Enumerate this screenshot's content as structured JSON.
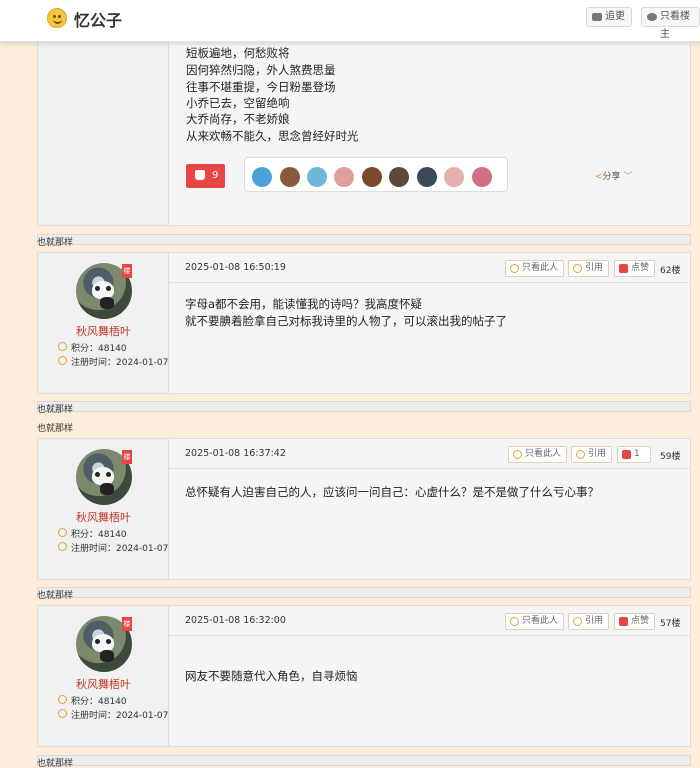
{
  "header": {
    "logo_text": "忆公子",
    "follow_label": "追更",
    "only_op_label": "只看楼主"
  },
  "first_post": {
    "poem_lines": [
      "短板遍地，何愁败将",
      "因何猝然归隐，外人煞费思量",
      "往事不堪重提，今日粉墨登场",
      "小乔已去，空留绝响",
      "大乔尚存，不老娇娘",
      "从来欢畅不能久，思念曾经好时光"
    ],
    "like_count": "9",
    "share_label": "分享",
    "share_arrow": "﹀",
    "likers": [
      "#4aa3d8",
      "#8a5a3c",
      "#6fb7d9",
      "#e0a0a0",
      "#7a4a2a",
      "#5a4a3a",
      "#3a4a5a",
      "#e6b0b0",
      "#d07080"
    ]
  },
  "signature": "也就那样",
  "posts": [
    {
      "badge": "楼",
      "username": "秋风舞梧叶",
      "points": "积分：48140",
      "reg_date": "注册时间：2024-01-07",
      "time": "2025-01-08 16:50:19",
      "only_this_label": "只看此人",
      "quote_label": "引用",
      "like_label": "点赞",
      "floor": "62楼",
      "text": [
        "字母a都不会用，能读懂我的诗吗？我高度怀疑",
        "就不要腆着脸拿自己对标我诗里的人物了，可以滚出我的帖子了"
      ]
    },
    {
      "badge": "楼",
      "username": "秋风舞梧叶",
      "points": "积分：48140",
      "reg_date": "注册时间：2024-01-07",
      "time": "2025-01-08 16:37:42",
      "only_this_label": "只看此人",
      "quote_label": "引用",
      "like_label": "1",
      "floor": "59楼",
      "text": [
        "总怀疑有人迫害自己的人，应该问一问自己：心虚什么？是不是做了什么亏心事？"
      ]
    },
    {
      "badge": "楼",
      "username": "秋风舞梧叶",
      "points": "积分：48140",
      "reg_date": "注册时间：2024-01-07",
      "time": "2025-01-08 16:32:00",
      "only_this_label": "只看此人",
      "quote_label": "引用",
      "like_label": "点赞",
      "floor": "57楼",
      "text": [
        "网友不要随意代入角色，自寻烦恼"
      ]
    }
  ]
}
